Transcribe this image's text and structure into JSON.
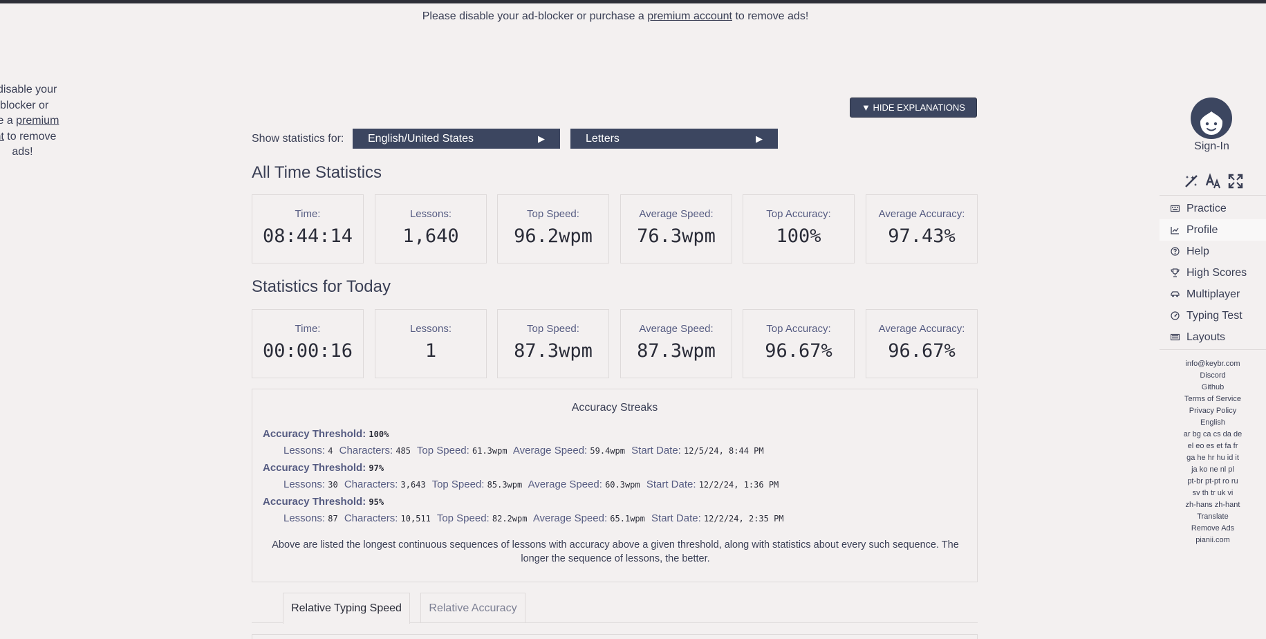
{
  "ad": {
    "top_prefix": "Please disable your ad-blocker or purchase a",
    "top_link": "premium account",
    "top_suffix": "to remove ads!",
    "left_line1": "e disable your",
    "left_line2": "-blocker or",
    "left_line3_prefix": "ase a",
    "left_line3_link": "premium",
    "left_line4_link": "unt",
    "left_line4_suffix": "to remove",
    "left_line5": "ads!"
  },
  "controls": {
    "hide_explanations": "▼ HIDE EXPLANATIONS",
    "show_stats_label": "Show statistics for:",
    "language_select": "English/United States",
    "mode_select": "Letters",
    "select_arrow": "▶"
  },
  "all_time": {
    "heading": "All Time Statistics",
    "cards": [
      {
        "label": "Time:",
        "value": "08:44:14"
      },
      {
        "label": "Lessons:",
        "value": "1,640"
      },
      {
        "label": "Top Speed:",
        "value": "96.2wpm"
      },
      {
        "label": "Average Speed:",
        "value": "76.3wpm"
      },
      {
        "label": "Top Accuracy:",
        "value": "100%"
      },
      {
        "label": "Average Accuracy:",
        "value": "97.43%"
      }
    ]
  },
  "today": {
    "heading": "Statistics for Today",
    "cards": [
      {
        "label": "Time:",
        "value": "00:00:16"
      },
      {
        "label": "Lessons:",
        "value": "1"
      },
      {
        "label": "Top Speed:",
        "value": "87.3wpm"
      },
      {
        "label": "Average Speed:",
        "value": "87.3wpm"
      },
      {
        "label": "Top Accuracy:",
        "value": "96.67%"
      },
      {
        "label": "Average Accuracy:",
        "value": "96.67%"
      }
    ]
  },
  "streaks": {
    "title": "Accuracy Streaks",
    "threshold_label": "Accuracy Threshold:",
    "lessons_label": "Lessons:",
    "characters_label": "Characters:",
    "top_speed_label": "Top Speed:",
    "average_speed_label": "Average Speed:",
    "start_date_label": "Start Date:",
    "rows": [
      {
        "threshold": "100%",
        "lessons": "4",
        "characters": "485",
        "top_speed": "61.3wpm",
        "average_speed": "59.4wpm",
        "start_date": "12/5/24, 8:44 PM"
      },
      {
        "threshold": "97%",
        "lessons": "30",
        "characters": "3,643",
        "top_speed": "85.3wpm",
        "average_speed": "60.3wpm",
        "start_date": "12/2/24, 1:36 PM"
      },
      {
        "threshold": "95%",
        "lessons": "87",
        "characters": "10,511",
        "top_speed": "82.2wpm",
        "average_speed": "65.1wpm",
        "start_date": "12/2/24, 2:35 PM"
      }
    ],
    "explanation": "Above are listed the longest continuous sequences of lessons with accuracy above a given threshold, along with statistics about every such sequence. The longer the sequence of lessons, the better."
  },
  "tabs": [
    {
      "label": "Relative Typing Speed",
      "active": true
    },
    {
      "label": "Relative Accuracy",
      "active": false
    }
  ],
  "sidebar": {
    "signin": "Sign-In",
    "nav": [
      {
        "label": "Practice",
        "icon": "keyboard-icon"
      },
      {
        "label": "Profile",
        "icon": "chart-icon",
        "active": true
      },
      {
        "label": "Help",
        "icon": "help-icon"
      },
      {
        "label": "High Scores",
        "icon": "trophy-icon"
      },
      {
        "label": "Multiplayer",
        "icon": "car-icon"
      },
      {
        "label": "Typing Test",
        "icon": "speedometer-icon"
      },
      {
        "label": "Layouts",
        "icon": "keyboard-layout-icon"
      }
    ],
    "links": {
      "email": "info@keybr.com",
      "discord": "Discord",
      "github": "Github",
      "terms": "Terms of Service",
      "privacy": "Privacy Policy",
      "language": "English",
      "lang_row1": "ar bg ca cs da de",
      "lang_row2": "el eo es et fa fr",
      "lang_row3": "ga he hr hu id it",
      "lang_row4": "ja ko ne nl pl",
      "lang_row5": "pt-br pt-pt ro ru",
      "lang_row6": "sv th tr uk vi",
      "lang_row7": "zh-hans zh-hant",
      "translate": "Translate",
      "remove_ads": "Remove Ads",
      "pianii": "pianii.com"
    }
  }
}
